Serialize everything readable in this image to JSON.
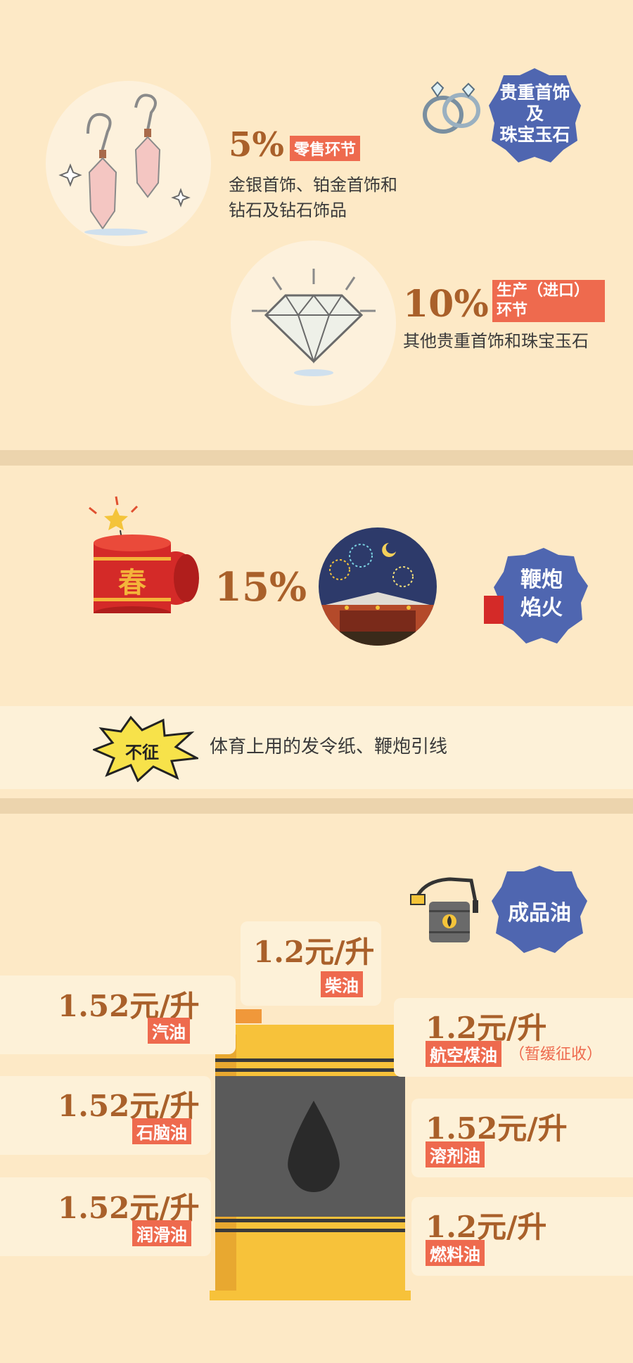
{
  "jewelry": {
    "badge": [
      "贵重首饰",
      "及",
      "珠宝玉石"
    ],
    "rate1": "5%",
    "tag1": "零售环节",
    "desc1": [
      "金银首饰、铂金首饰和",
      "钻石及钻石饰品"
    ],
    "rate2": "10%",
    "tag2": [
      "生产（进口）",
      "环节"
    ],
    "desc2": "其他贵重首饰和珠宝玉石"
  },
  "fireworks": {
    "rate": "15%",
    "badge": [
      "鞭炮",
      "焰火"
    ],
    "exempt_tag": "不征",
    "exempt_desc": "体育上用的发令纸、鞭炮引线",
    "chun_char": "春"
  },
  "oil": {
    "badge": "成品油",
    "items": {
      "diesel": {
        "price": "1.2元/升",
        "label": "柴油"
      },
      "gasoline": {
        "price": "1.52元/升",
        "label": "汽油"
      },
      "aviation": {
        "price": "1.2元/升",
        "label": "航空煤油",
        "note": "（暂缓征收）"
      },
      "naphtha": {
        "price": "1.52元/升",
        "label": "石脑油"
      },
      "solvent": {
        "price": "1.52元/升",
        "label": "溶剂油"
      },
      "lubricant": {
        "price": "1.52元/升",
        "label": "润滑油"
      },
      "fuel": {
        "price": "1.2元/升",
        "label": "燃料油"
      }
    }
  },
  "colors": {
    "background": "#fde9c6",
    "accent_orange": "#ee6a4e",
    "badge_blue": "#4f66b0",
    "percent_brown": "#a9602a"
  }
}
